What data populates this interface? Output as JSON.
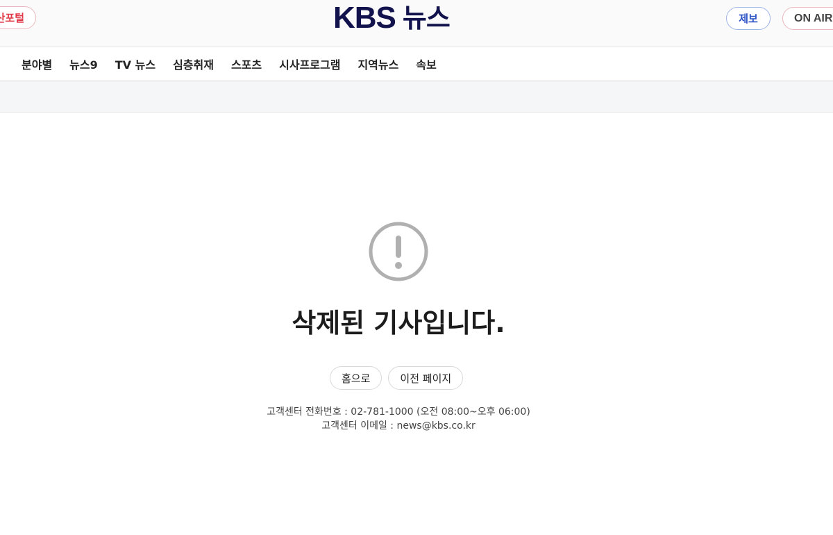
{
  "header": {
    "portal_label": "한국 포털",
    "portal_visible": "산포털",
    "logo_kbs": "KBS",
    "logo_news": "뉴스",
    "report_label": "제보",
    "onair_label": "ON AIR"
  },
  "nav": {
    "items": [
      {
        "label": "분야별"
      },
      {
        "label": "뉴스9"
      },
      {
        "label": "TV 뉴스"
      },
      {
        "label": "심층취재"
      },
      {
        "label": "스포츠"
      },
      {
        "label": "시사프로그램"
      },
      {
        "label": "지역뉴스"
      },
      {
        "label": "속보"
      }
    ]
  },
  "main": {
    "message": "삭제된 기사입니다.",
    "home_button": "홈으로",
    "prev_button": "이전 페이지",
    "contact_phone": "고객센터 전화번호 : 02-781-1000 (오전 08:00~오후 06:00)",
    "contact_email": "고객센터 이메일 : news@kbs.co.kr"
  },
  "colors": {
    "logo": "#12134d",
    "portal_red": "#e03a48",
    "report_blue": "#2f55c6",
    "icon_gray": "#b0b0b0"
  },
  "icons": {
    "alert": "exclamation-circle-icon"
  }
}
